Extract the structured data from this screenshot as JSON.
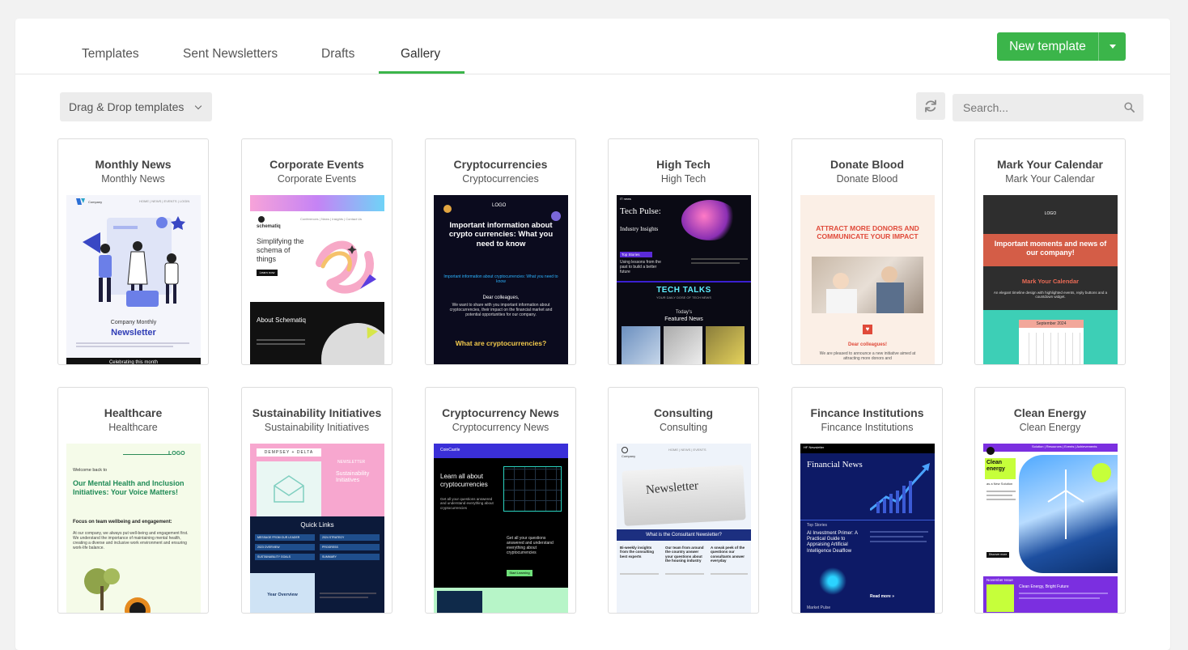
{
  "tabs": [
    {
      "label": "Templates",
      "active": false
    },
    {
      "label": "Sent Newsletters",
      "active": false
    },
    {
      "label": "Drafts",
      "active": false
    },
    {
      "label": "Gallery",
      "active": true
    }
  ],
  "new_template": {
    "label": "New template"
  },
  "filter": {
    "selected": "Drag & Drop templates"
  },
  "search": {
    "placeholder": "Search..."
  },
  "colors": {
    "accent": "#3bb54a",
    "toolbar_bg": "#ececec"
  },
  "cards": [
    {
      "title": "Monthly News",
      "subtitle": "Monthly News",
      "thumb": {
        "brand": "Company",
        "nav": "HOME | NEWS | EVENTS | LOGIN",
        "small": "Company Monthly",
        "big": "Newsletter",
        "footer": "Celebrating this month"
      }
    },
    {
      "title": "Corporate Events",
      "subtitle": "Corporate Events",
      "thumb": {
        "brand": "schematiq",
        "nav": "Conferences | News | Insights | Contact Us",
        "headline": "Simplifying the schema of things",
        "cta": "Learn now",
        "section": "About Schematiq"
      }
    },
    {
      "title": "Cryptocurrencies",
      "subtitle": "Cryptocurrencies",
      "thumb": {
        "logo": "LOGO",
        "headline": "Important information about crypto currencies: What you need to know",
        "link": "Important information about cryptocurrencies: What you need to know",
        "greeting": "Dear colleagues,",
        "body": "We want to share with you important information about cryptocurrencies, their impact on the financial market and potential opportunities for our company.",
        "question": "What are cryptocurrencies?"
      }
    },
    {
      "title": "High Tech",
      "subtitle": "High Tech",
      "thumb": {
        "brand": "IT news",
        "headline": "Tech Pulse:",
        "tagline": "Industry Insights",
        "tag": "Top Stories",
        "story": "Using lessons from the past to build a better future",
        "banner": "TECH TALKS",
        "banner_sub": "YOUR DAILY DOSE OF TECH NEWS",
        "today": "Today's",
        "featured": "Featured News"
      }
    },
    {
      "title": "Donate Blood",
      "subtitle": "Donate Blood",
      "thumb": {
        "headline": "ATTRACT MORE DONORS AND COMMUNICATE YOUR IMPACT",
        "greeting": "Dear colleagues!",
        "body": "We are pleased to announce a new initiative aimed at attracting more donors and"
      }
    },
    {
      "title": "Mark Your Calendar",
      "subtitle": "Mark Your Calendar",
      "thumb": {
        "logo": "LOGO",
        "headline": "Important moments and news of our company!",
        "sub": "Mark Your Calendar",
        "body": "An elegant timeline design with highlighted events, reply buttons and a countdown widget.",
        "month": "September 2024"
      }
    },
    {
      "title": "Healthcare",
      "subtitle": "Healthcare",
      "thumb": {
        "logo": "LOGO",
        "welcome": "Welcome back to",
        "headline": "Our Mental Health and Inclusion Initiatives: Your Voice Matters!",
        "focus": "Focus on team wellbeing and engagement:",
        "body": "At our company, we always put well-being and engagement first. We understand the importance of maintaining mental health, creating a diverse and inclusive work environment and ensuring work-life balance."
      }
    },
    {
      "title": "Sustainability Initiatives",
      "subtitle": "Sustainability Initiatives",
      "thumb": {
        "brand": "DEMPSEY + DELTA",
        "tag": "NEWSLETTER",
        "headline": "Sustainability Initiatives",
        "links_title": "Quick Links",
        "links": [
          "MESSAGE FROM OUR LEADER",
          "2024 STRATEGY",
          "2023 OVERVIEW",
          "PROGRESS",
          "SUSTAINABILITY GOALS",
          "SUMMARY"
        ],
        "section": "Year Overview"
      }
    },
    {
      "title": "Cryptocurrency News",
      "subtitle": "Cryptocurrency News",
      "thumb": {
        "brand": "CoinCastle",
        "headline": "Learn all about cryptocurrencies",
        "body": "Get all your questions answered and understand everything about cryptocurrencies",
        "cta": "Start Learning"
      }
    },
    {
      "title": "Consulting",
      "subtitle": "Consulting",
      "thumb": {
        "brand": "Company",
        "nav": "HOME | NEWS | EVENTS",
        "paper": "Newsletter",
        "headline": "What is the Consultant Newsletter?",
        "col1": "Bi-weekly insights from the consulting best experts",
        "col2": "Our team from around the country answer your questions about the housing industry",
        "col3": "A sneak peek of the questions our consultants answer everyday"
      }
    },
    {
      "title": "Fincance Institutions",
      "subtitle": "Fincance Institutions",
      "thumb": {
        "brand": "HF Newsletter",
        "headline": "Financial News",
        "tag": "Top Stories",
        "story": "AI Investment Primer: A Practical Guide to Appraising Artificial Intelligence Dealflow",
        "more": "Read more »",
        "footer": "Market Pulse"
      }
    },
    {
      "title": "Clean Energy",
      "subtitle": "Clean Energy",
      "thumb": {
        "nav": "Solution | Resources | Events | Achievements",
        "headline": "Clean energy",
        "sub": "as a New Solution",
        "cta": "Discover more",
        "tag": "November Issue",
        "story": "Clean Energy, Bright Future"
      }
    }
  ]
}
